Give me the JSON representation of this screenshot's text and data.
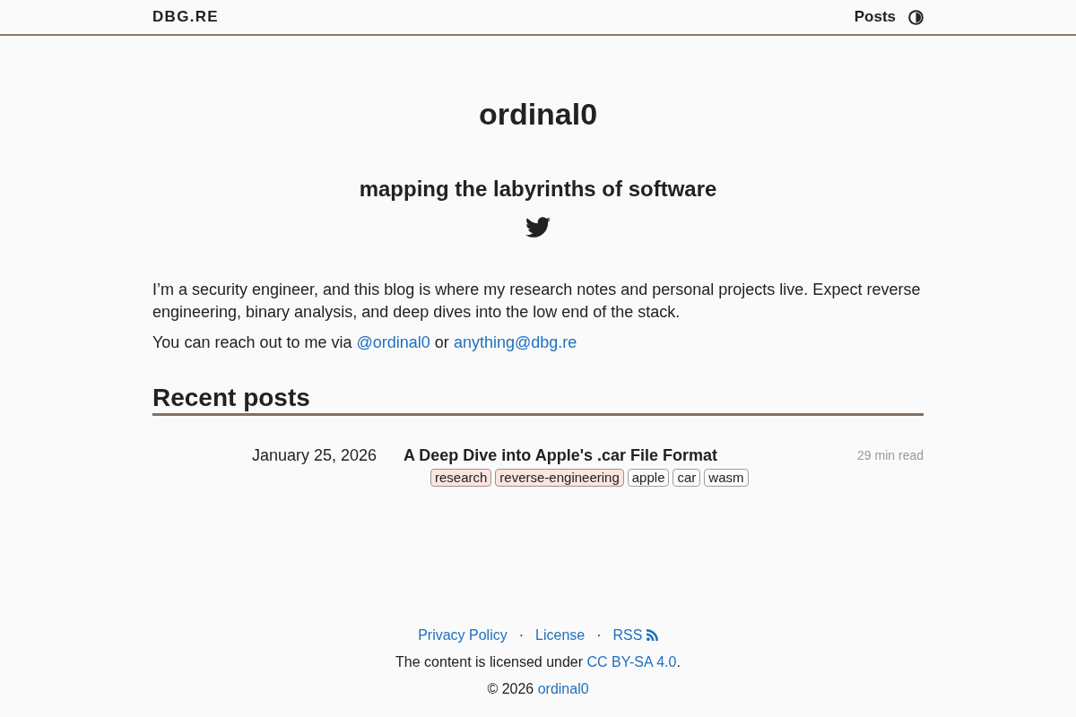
{
  "header": {
    "site_title": "DBG.RE",
    "nav": [
      {
        "label": "Posts"
      }
    ]
  },
  "hero": {
    "title": "ordinal0",
    "subtitle": "mapping the labyrinths of software"
  },
  "intro": {
    "paragraphs": [
      [
        {
          "kind": "text",
          "text": "I’m a security engineer, and this blog is where my research notes and personal projects live. Expect reverse engineering, binary analysis, and deep dives into the low end of the stack."
        }
      ],
      [
        {
          "kind": "text",
          "text": "You can reach out to me via"
        },
        {
          "kind": "link",
          "text": "@ordinal0"
        },
        {
          "kind": "text",
          "text": "or"
        },
        {
          "kind": "link",
          "text": "anything@dbg.re"
        }
      ]
    ]
  },
  "recent_posts": {
    "heading": "Recent posts",
    "posts": [
      {
        "date": "January 25, 2026",
        "title": "A Deep Dive into Apple's .car File Format",
        "read_time": "29 min read",
        "tags": [
          {
            "label": "research",
            "color": "#f9e4df"
          },
          {
            "label": "reverse-engineering",
            "color": "#f9e4df"
          },
          {
            "label": "apple",
            "color": "#fafafa"
          },
          {
            "label": "car",
            "color": "#fafafa"
          },
          {
            "label": "wasm",
            "color": "#fafafa"
          }
        ]
      }
    ]
  },
  "footer": {
    "links": [
      {
        "kind": "link",
        "label": "Privacy Policy"
      },
      {
        "kind": "separator",
        "label": "·"
      },
      {
        "kind": "link",
        "label": "License"
      },
      {
        "kind": "separator",
        "label": "·"
      },
      {
        "kind": "feed",
        "label": "RSS"
      }
    ],
    "license": [
      {
        "kind": "text",
        "text": "The content is licensed under"
      },
      {
        "kind": "link",
        "text": "CC BY-SA 4.0"
      },
      {
        "kind": "text",
        "text": "."
      }
    ],
    "copyright": [
      {
        "kind": "text",
        "text": "© 2026"
      },
      {
        "kind": "link",
        "text": "ordinal0"
      }
    ]
  }
}
